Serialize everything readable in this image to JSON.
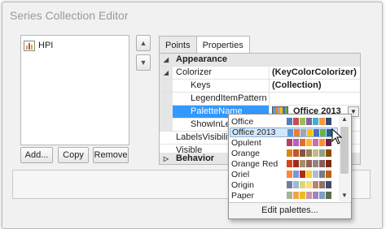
{
  "window": {
    "title": "Series Collection Editor"
  },
  "series_list": {
    "items": [
      {
        "label": "HPI",
        "icon": "bar-chart-icon"
      }
    ]
  },
  "buttons": {
    "add": "Add...",
    "copy": "Copy",
    "remove": "Remove",
    "up": "▲",
    "down": "▼"
  },
  "tabs": [
    {
      "label": "Points",
      "active": false
    },
    {
      "label": "Properties",
      "active": true
    }
  ],
  "grid": {
    "rows": [
      {
        "name": "Appearance",
        "value": "",
        "category": true,
        "expander": "◢"
      },
      {
        "name": "Colorizer",
        "value": "(KeyColorColorizer)",
        "expander": "◢"
      },
      {
        "name": "Keys",
        "value": "(Collection)"
      },
      {
        "name": "LegendItemPattern",
        "value": ""
      },
      {
        "name": "PaletteName",
        "value": "Office 2013",
        "selected": true
      },
      {
        "name": "ShowInLeg",
        "value": ""
      },
      {
        "name": "LabelsVisibility",
        "value": ""
      },
      {
        "name": "Visible",
        "value": ""
      },
      {
        "name": "Behavior",
        "value": "",
        "category": true,
        "expander": "▷"
      }
    ]
  },
  "palette_dropdown": {
    "selected": "Office 2013",
    "edit_label": "Edit palettes...",
    "items": [
      {
        "label": "Office",
        "colors": [
          "#4f81bd",
          "#c0504d",
          "#9bbb59",
          "#8064a2",
          "#4bacc6",
          "#f79646",
          "#2c4d75",
          "#772c2a"
        ]
      },
      {
        "label": "Office 2013",
        "colors": [
          "#5b9bd5",
          "#ed7d31",
          "#a5a5a5",
          "#ffc000",
          "#4472c4",
          "#70ad47",
          "#255e91",
          "#9e480e"
        ]
      },
      {
        "label": "Opulent",
        "colors": [
          "#b83d68",
          "#ac66bb",
          "#de6c36",
          "#f9b639",
          "#cf6da4",
          "#fa8d3d",
          "#6b2249",
          "#5f2f6a"
        ]
      },
      {
        "label": "Orange",
        "colors": [
          "#e48312",
          "#bd582c",
          "#865640",
          "#9b8357",
          "#c2bc80",
          "#94a088",
          "#8a4e0b",
          "#713417"
        ]
      },
      {
        "label": "Orange Red",
        "colors": [
          "#d34817",
          "#9b2d1f",
          "#a28e6a",
          "#956251",
          "#918485",
          "#855d5d",
          "#7e2b0e",
          "#5c1a12"
        ]
      },
      {
        "label": "Oriel",
        "colors": [
          "#fe8637",
          "#7598d9",
          "#b32c16",
          "#f5cd2d",
          "#aebad5",
          "#777c84",
          "#c85c0a",
          "#3d5f9b"
        ]
      },
      {
        "label": "Origin",
        "colors": [
          "#727ca3",
          "#9fb8cd",
          "#d2da7a",
          "#fada7a",
          "#b88472",
          "#8e736a",
          "#434b6a",
          "#567692"
        ]
      },
      {
        "label": "Paper",
        "colors": [
          "#a5b592",
          "#f3a447",
          "#e7bc29",
          "#d092a7",
          "#9c85c0",
          "#809ec2",
          "#5e6d4c",
          "#a85f09"
        ]
      }
    ]
  },
  "selected_palette_colors": [
    "#5b9bd5",
    "#ed7d31",
    "#a5a5a5",
    "#ffc000",
    "#4472c4",
    "#70ad47"
  ]
}
